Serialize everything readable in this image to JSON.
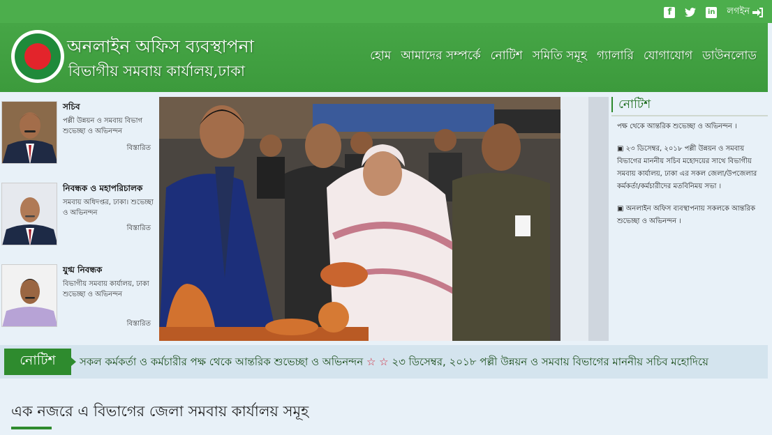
{
  "topbar": {
    "social": [
      {
        "icon": "facebook-icon",
        "glyph": "f"
      },
      {
        "icon": "twitter-icon",
        "glyph": "t"
      },
      {
        "icon": "linkedin-icon",
        "glyph": "in"
      }
    ],
    "login_label": "লগইন"
  },
  "header": {
    "title": "অনলাইন অফিস ব্যবস্থাপনা",
    "subtitle": "বিভাগীয় সমবায় কার্যালয়,ঢাকা",
    "nav": [
      "হোম",
      "আমাদের সম্পর্কে",
      "নোটিশ",
      "সমিতি সমূহ",
      "গ্যালারি",
      "যোগাযোগ",
      "ডাউনলোড"
    ]
  },
  "officials": [
    {
      "title": "সচিব",
      "desc": "পল্লী উন্নয়ন ও সমবায় বিভাগ শুভেচ্ছা ও অভিনন্দন",
      "more": "বিস্তারিত"
    },
    {
      "title": "নিবন্ধক ও মহাপরিচালক",
      "desc": "সমবায় অধিদপ্তর, ঢাকা। শুভেচ্ছা ও অভিনন্দন",
      "more": "বিস্তারিত"
    },
    {
      "title": "যুগ্ম নিবন্ধক",
      "desc": "বিভাগীয় সমবায় কার্যালয়, ঢাকা শুভেচ্ছা ও অভিনন্দন",
      "more": "বিস্তারিত"
    }
  ],
  "notice_panel": {
    "title": "নোটিশ",
    "items": [
      "পক্ষ থেকে আন্তরিক শুভেচ্ছা ও অভিনন্দন ।",
      "▣ ২৩ ডিসেম্বর, ২০১৮ পল্লী উন্নয়ন ও সমবায় বিভাগের মাননীয় সচিব মহোদয়ের সাথে বিভাগীয় সমবায় কার্যালয়, ঢাকা এর সকল জেলা/উপজেলার কর্মকর্তা/কর্মচারীদের মতবিনিময় সভা ।",
      "▣ অনলাইন অফিস ব্যবস্থাপনায় সকলকে আন্তরিক শুভেচ্ছা ও অভিনন্দন ।"
    ]
  },
  "ticker": {
    "label": "নোটিশ",
    "text_1": "সকল কর্মকর্তা ও কর্মচারীর পক্ষ থেকে আন্তরিক শুভেচ্ছা ও অভিনন্দন",
    "stars": "☆ ☆",
    "text_2": "২৩ ডিসেম্বর, ২০১৮ পল্লী উন্নয়ন ও সমবায় বিভাগের মাননীয় সচিব মহোদিয়ে"
  },
  "section": {
    "title": "এক নজরে এ বিভাগের জেলা সমবায় কার্যালয় সমূহ"
  },
  "colors": {
    "brand_green": "#4cae4c",
    "dark_green": "#2e8b2e",
    "page_bg": "#e8f1f8"
  }
}
